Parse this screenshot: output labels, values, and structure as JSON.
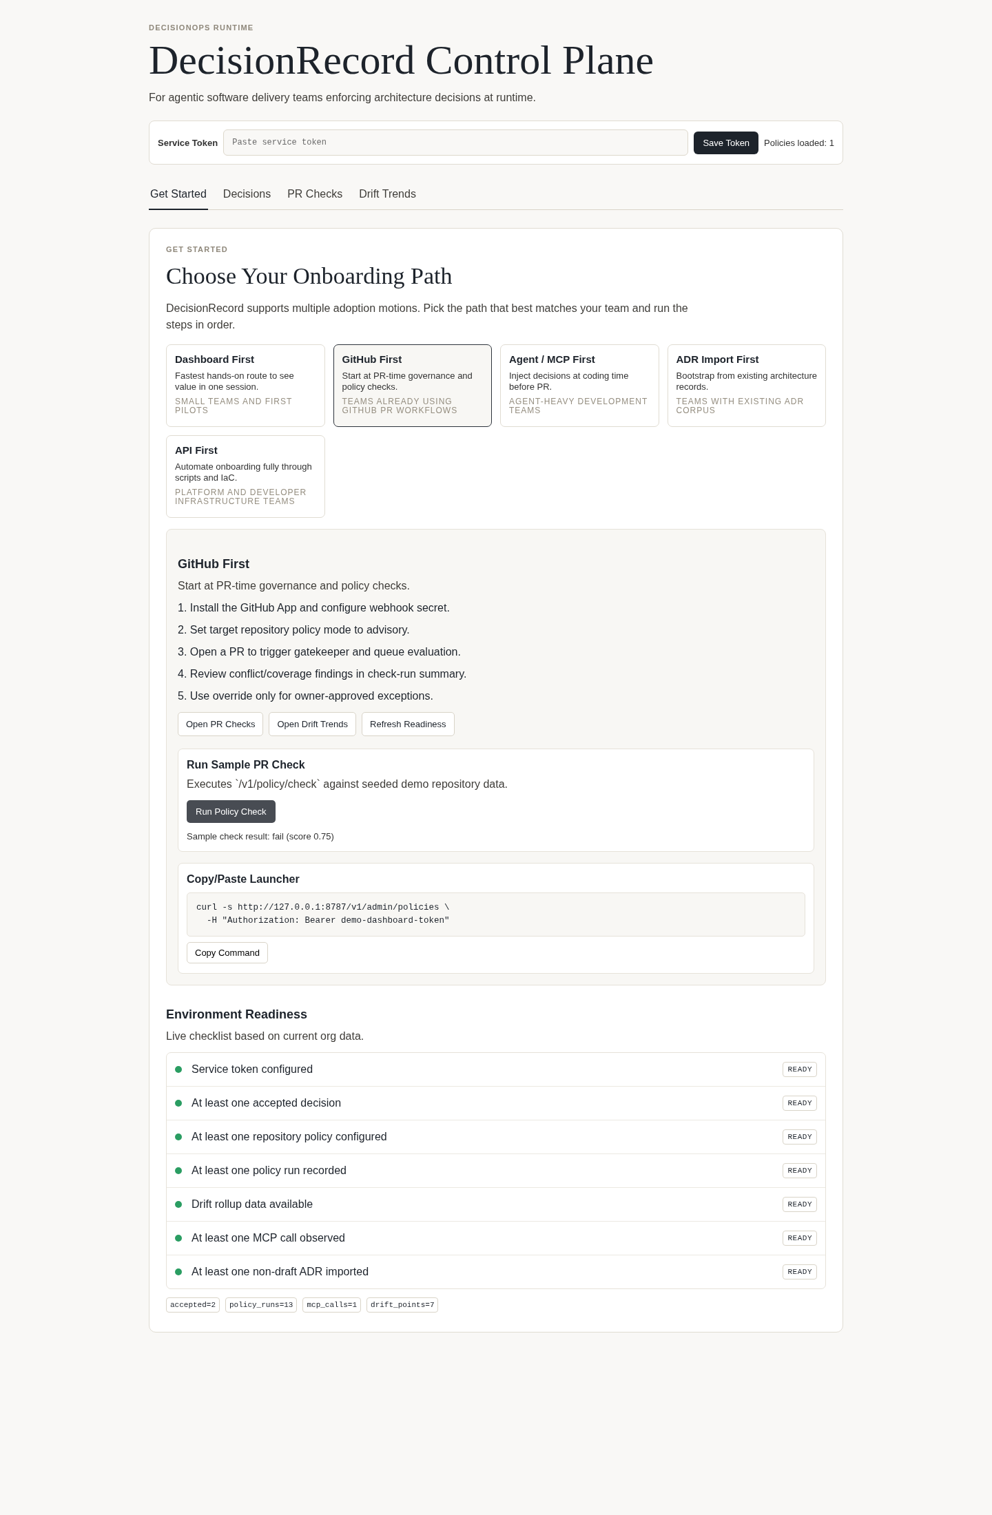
{
  "header": {
    "eyebrow": "DECISIONOPS RUNTIME",
    "title": "DecisionRecord Control Plane",
    "subtitle": "For agentic software delivery teams enforcing architecture decisions at runtime."
  },
  "token_bar": {
    "label": "Service Token",
    "placeholder": "Paste service token",
    "button": "Save Token",
    "status": "Policies loaded: 1"
  },
  "tabs": [
    {
      "label": "Get Started",
      "selected": true
    },
    {
      "label": "Decisions",
      "selected": false
    },
    {
      "label": "PR Checks",
      "selected": false
    },
    {
      "label": "Drift Trends",
      "selected": false
    }
  ],
  "panel": {
    "eyebrow": "GET STARTED",
    "title": "Choose Your Onboarding Path",
    "intro": "DecisionRecord supports multiple adoption motions. Pick the path that best matches your team and run the steps in order.",
    "paths": [
      {
        "title": "Dashboard First",
        "description": "Fastest hands-on route to see value in one session.",
        "audience": "SMALL TEAMS AND FIRST PILOTS",
        "selected": false
      },
      {
        "title": "GitHub First",
        "description": "Start at PR-time governance and policy checks.",
        "audience": "TEAMS ALREADY USING GITHUB PR WORKFLOWS",
        "selected": true
      },
      {
        "title": "Agent / MCP First",
        "description": "Inject decisions at coding time before PR.",
        "audience": "AGENT-HEAVY DEVELOPMENT TEAMS",
        "selected": false
      },
      {
        "title": "ADR Import First",
        "description": "Bootstrap from existing architecture records.",
        "audience": "TEAMS WITH EXISTING ADR CORPUS",
        "selected": false
      },
      {
        "title": "API First",
        "description": "Automate onboarding fully through scripts and IaC.",
        "audience": "PLATFORM AND DEVELOPER INFRASTRUCTURE TEAMS",
        "selected": false
      }
    ],
    "detail": {
      "title": "GitHub First",
      "description": "Start at PR-time governance and policy checks.",
      "steps": [
        "1. Install the GitHub App and configure webhook secret.",
        "2. Set target repository policy mode to advisory.",
        "3. Open a PR to trigger gatekeeper and queue evaluation.",
        "4. Review conflict/coverage findings in check-run summary.",
        "5. Use override only for owner-approved exceptions."
      ],
      "actions": [
        "Open PR Checks",
        "Open Drift Trends",
        "Refresh Readiness"
      ],
      "sample_check": {
        "title": "Run Sample PR Check",
        "description": "Executes `/v1/policy/check` against seeded demo repository data.",
        "button": "Run Policy Check",
        "result": "Sample check result: fail (score 0.75)"
      },
      "launcher": {
        "title": "Copy/Paste Launcher",
        "code": "curl -s http://127.0.0.1:8787/v1/admin/policies \\\n  -H \"Authorization: Bearer demo-dashboard-token\"",
        "button": "Copy Command"
      }
    },
    "readiness": {
      "title": "Environment Readiness",
      "description": "Live checklist based on current org data.",
      "items": [
        {
          "label": "Service token configured",
          "status": "READY",
          "ready": true
        },
        {
          "label": "At least one accepted decision",
          "status": "READY",
          "ready": true
        },
        {
          "label": "At least one repository policy configured",
          "status": "READY",
          "ready": true
        },
        {
          "label": "At least one policy run recorded",
          "status": "READY",
          "ready": true
        },
        {
          "label": "Drift rollup data available",
          "status": "READY",
          "ready": true
        },
        {
          "label": "At least one MCP call observed",
          "status": "READY",
          "ready": true
        },
        {
          "label": "At least one non-draft ADR imported",
          "status": "READY",
          "ready": true
        }
      ],
      "metrics": [
        "accepted=2",
        "policy_runs=13",
        "mcp_calls=1",
        "drift_points=7"
      ]
    }
  }
}
